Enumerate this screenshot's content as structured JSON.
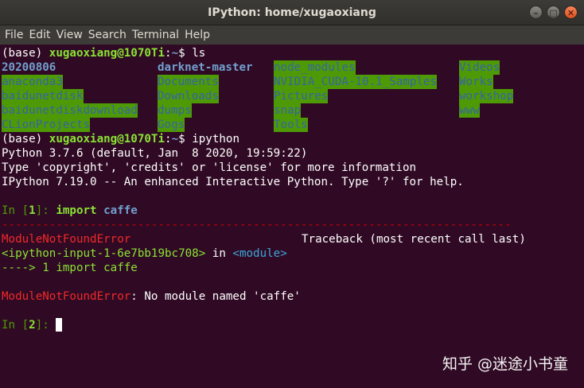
{
  "window": {
    "title": "IPython: home/xugaoxiang",
    "controls": [
      "–",
      "□",
      "✕"
    ]
  },
  "menu": [
    "File",
    "Edit",
    "View",
    "Search",
    "Terminal",
    "Help"
  ],
  "terminal": {
    "prompt1": {
      "env": "(base) ",
      "user": "xugaoxiang@1070Ti",
      "sep": ":",
      "path": "~",
      "cmd": "$ ls"
    },
    "ls": [
      [
        "20200806",
        "darknet-master",
        "node_modules",
        "Videos"
      ],
      [
        "anaconda3",
        "Documents",
        "NVIDIA_CUDA-10.1_Samples",
        "Works"
      ],
      [
        "baidunetdisk",
        "Downloads",
        "Pictures",
        "workshop"
      ],
      [
        "baidunetdiskdownload",
        "dumps",
        "snap",
        "www"
      ],
      [
        "CLionProjects",
        "Gogs",
        "Tools",
        ""
      ]
    ],
    "prompt2": {
      "env": "(base) ",
      "user": "xugaoxiang@1070Ti",
      "sep": ":",
      "path": "~",
      "cmd": "$ ipython"
    },
    "banner": [
      "Python 3.7.6 (default, Jan  8 2020, 19:59:22)",
      "Type 'copyright', 'credits' or 'license' for more information",
      "IPython 7.19.0 -- An enhanced Interactive Python. Type '?' for help."
    ],
    "in1": {
      "in": "In [",
      "num": "1",
      "close": "]: ",
      "kw": "import",
      "mod": "caffe"
    },
    "dashes": "---------------------------------------------------------------------------",
    "error_name": "ModuleNotFoundError",
    "traceback": "Traceback (most recent call last)",
    "input_ref": "<ipython-input-1-6e7bb19bc708>",
    "in_word": " in ",
    "module_ref": "<module>",
    "arrow_line": "----> 1 import caffe",
    "error_msg": ": No module named 'caffe'",
    "in2": {
      "in": "In [",
      "num": "2",
      "close": "]: "
    }
  },
  "watermark": "知乎 @迷途小书童"
}
